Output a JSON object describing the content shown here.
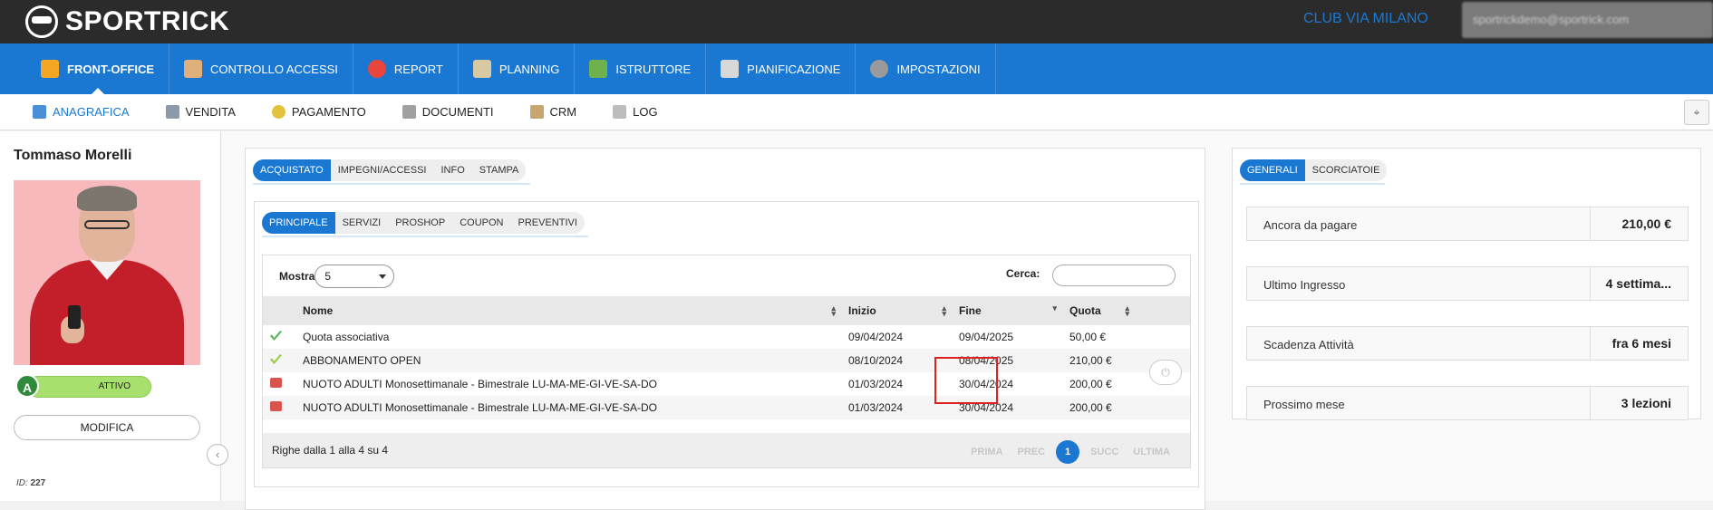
{
  "brand": {
    "name": "SPORTRICK"
  },
  "header": {
    "club": "CLUB VIA MILANO",
    "user_email": "sportrickdemo@sportrick.com"
  },
  "main_nav": [
    {
      "label": "FRONT-OFFICE",
      "icon": "person-icon",
      "color": "#f5a623"
    },
    {
      "label": "CONTROLLO ACCESSI",
      "icon": "turnstile-icon",
      "color": "#e0b07a"
    },
    {
      "label": "REPORT",
      "icon": "pie-chart-icon",
      "color": "#e8453c"
    },
    {
      "label": "PLANNING",
      "icon": "calendar-grid-icon",
      "color": "#d9c9a3"
    },
    {
      "label": "ISTRUTTORE",
      "icon": "trainers-icon",
      "color": "#6fb24b"
    },
    {
      "label": "PIANIFICAZIONE",
      "icon": "calendar-icon",
      "color": "#d8d8d8"
    },
    {
      "label": "IMPOSTAZIONI",
      "icon": "gear-icon",
      "color": "#9a9a9a"
    }
  ],
  "sub_nav": [
    {
      "label": "ANAGRAFICA",
      "icon": "person-icon",
      "color": "#4a90d9"
    },
    {
      "label": "VENDITA",
      "icon": "cash-register-icon",
      "color": "#8a9aa8"
    },
    {
      "label": "PAGAMENTO",
      "icon": "coin-icon",
      "color": "#e2c23a"
    },
    {
      "label": "DOCUMENTI",
      "icon": "document-icon",
      "color": "#a0a0a0"
    },
    {
      "label": "CRM",
      "icon": "handshake-icon",
      "color": "#c8a46e"
    },
    {
      "label": "LOG",
      "icon": "log-icon",
      "color": "#bdbdbd"
    }
  ],
  "profile": {
    "name": "Tommaso Morelli",
    "badge": "A",
    "status": "ATTIVO",
    "edit_label": "MODIFICA",
    "id_label": "ID:",
    "id_value": "227"
  },
  "left_tabs": [
    "ACQUISTATO",
    "IMPEGNI/ACCESSI",
    "INFO",
    "STAMPA"
  ],
  "inner_tabs": [
    "PRINCIPALE",
    "SERVIZI",
    "PROSHOP",
    "COUPON",
    "PREVENTIVI"
  ],
  "table": {
    "show_label": "Mostra",
    "page_size": "5",
    "search_label": "Cerca:",
    "search_value": "",
    "columns": [
      "Nome",
      "Inizio",
      "Fine",
      "Quota"
    ],
    "rows": [
      {
        "icon": "check-icon",
        "icon_color": "#5cb85c",
        "name": "Quota associativa",
        "start": "09/04/2024",
        "end": "09/04/2025",
        "quota": "50,00 €"
      },
      {
        "icon": "check-partial-icon",
        "icon_color": "#9ccc4a",
        "name": "ABBONAMENTO OPEN",
        "start": "08/10/2024",
        "end": "08/04/2025",
        "quota": "210,00 €"
      },
      {
        "icon": "calendar-small-icon",
        "icon_color": "#d9534f",
        "name": "NUOTO ADULTI Monosettimanale - Bimestrale LU-MA-ME-GI-VE-SA-DO",
        "start": "01/03/2024",
        "end": "30/04/2024",
        "quota": "200,00 €"
      },
      {
        "icon": "calendar-small-icon",
        "icon_color": "#d9534f",
        "name": "NUOTO ADULTI Monosettimanale - Bimestrale LU-MA-ME-GI-VE-SA-DO",
        "start": "01/03/2024",
        "end": "30/04/2024",
        "quota": "200,00 €"
      }
    ],
    "footer_info": "Righe dalla 1 alla 4 su 4",
    "pager": {
      "first": "PRIMA",
      "prev": "PREC",
      "current": "1",
      "next": "SUCC",
      "last": "ULTIMA"
    }
  },
  "right_tabs": [
    "GENERALI",
    "SCORCIATOIE"
  ],
  "stats": [
    {
      "label": "Ancora da pagare",
      "value": "210,00 €"
    },
    {
      "label": "Ultimo Ingresso",
      "value": "4 settima..."
    },
    {
      "label": "Scadenza Attività",
      "value": "fra 6 mesi"
    },
    {
      "label": "Prossimo mese",
      "value": "3 lezioni"
    }
  ]
}
